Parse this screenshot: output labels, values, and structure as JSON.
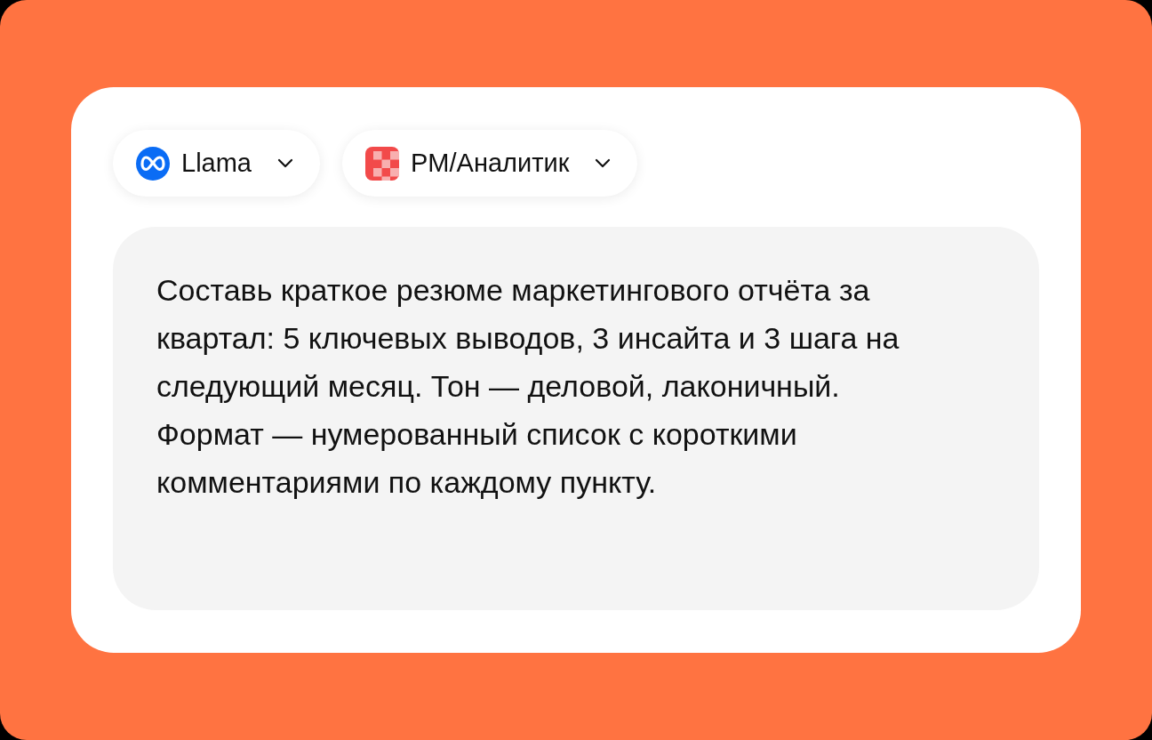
{
  "selectors": [
    {
      "kind": "model",
      "label": "Llama"
    },
    {
      "kind": "role",
      "label": "PM/Аналитик"
    }
  ],
  "prompt": {
    "value": "Составь краткое резюме маркетингового отчёта за квартал: 5 ключевых выводов, 3 инсайта и 3 шага на следующий месяц. Тон — деловой, лаконичный. Формат — нумерованный список с короткими комментариями по каждому пункту."
  }
}
